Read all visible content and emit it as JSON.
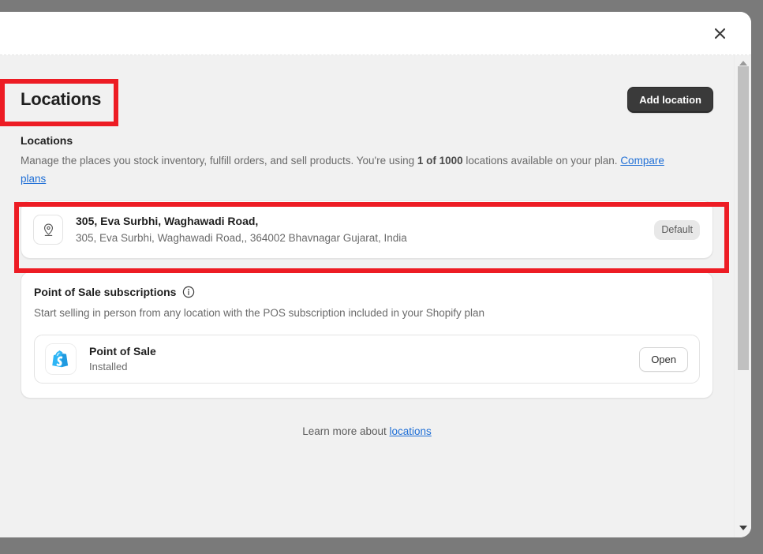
{
  "modal": {
    "close_label": "Close",
    "close_icon": "close-icon"
  },
  "page": {
    "title": "Locations",
    "add_button_label": "Add location"
  },
  "locations_section": {
    "heading": "Locations",
    "description_part1": "Manage the places you stock inventory, fulfill orders, and sell products. You're using ",
    "description_bold": "1 of 1000",
    "description_part2": " locations available on your plan. ",
    "compare_plans_link": "Compare plans"
  },
  "location_card": {
    "icon": "location-pin-icon",
    "name": "305, Eva Surbhi, Waghawadi Road,",
    "address": "305, Eva Surbhi, Waghawadi Road,, 364002 Bhavnagar Gujarat, India",
    "badge": "Default"
  },
  "pos_section": {
    "title": "Point of Sale subscriptions",
    "info_icon": "info-circle-icon",
    "description": "Start selling in person from any location with the POS subscription included in your Shopify plan",
    "app": {
      "icon": "shopify-pos-icon",
      "name": "Point of Sale",
      "status": "Installed",
      "open_button_label": "Open"
    }
  },
  "footer": {
    "learn_more_prefix": "Learn more about ",
    "learn_more_link": "locations"
  },
  "scrollbar": {
    "up_icon": "chevron-up-icon",
    "down_icon": "chevron-down-icon"
  },
  "colors": {
    "annotation_red": "#ed1c24",
    "link_blue": "#1f6fd6",
    "primary_button": "#3a3a3a",
    "backdrop": "#7a7a7a",
    "body_background": "#f1f1f1"
  }
}
